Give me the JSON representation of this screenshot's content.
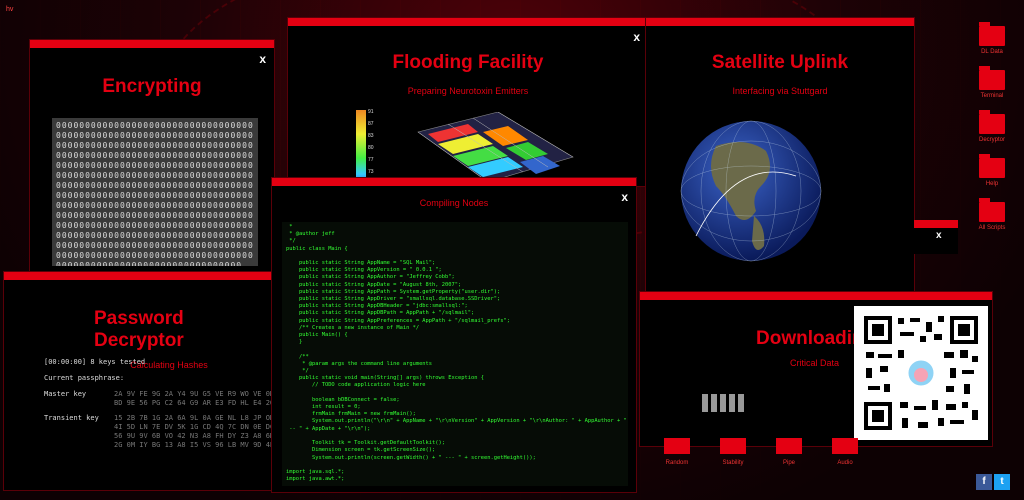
{
  "corner_label": "hv",
  "encrypting": {
    "title": "Encrypting",
    "close": "x",
    "grid": "0000000000000000000000000000000000000000000000000000000000000000000000000000000000000000000000000000000000000000000000000000000000000000000000000000000000000000000000000000000000000000000000000000000000000000000000000000000000000000000000000000000000000000000000000000000000000000000000000000000000000000000000000000000000000000000000000000000000000000000000000000000000000000000000000000000000000000000000000000000000000000000000000000000000000000000000000000000000000000000000000000000000000000000000000000"
  },
  "password": {
    "title": "Password Decryptor",
    "subtitle": "Calculating Hashes",
    "status": "[00:00:00] 8 keys tested",
    "passphrase": "Current passphrase: ",
    "master_label": "Master key",
    "master_value": "2A 9V FE 9G 2A Y4 9U G5 VE R9 WO VE 0D\nBD 9E 56 PG C2 64 G9 AR E3 FD HL E4 20",
    "transient_label": "Transient key",
    "transient_value": "15 2B 7B 1G 2A 6A 9L 0A GE NL L8 JP OK\n4I 5D LN 7E DV 5K 1G CD 4Q 7C DN 0E DC\n56 9U 9V 6B VO 42 N3 A8 FH DY Z3 A8 6D\n2G 0M IY BG 13 A8 I5 VS 96 LB MV 9D 4E"
  },
  "flood": {
    "title": "Flooding Facility",
    "subtitle": "Preparing Neurotoxin Emitters",
    "legend": [
      "91",
      "87",
      "83",
      "80",
      "77",
      "73"
    ]
  },
  "satellite": {
    "title": "Satellite Uplink",
    "subtitle": "Interfacing via Stuttgard",
    "close": "x"
  },
  "code": {
    "title": "Compiling Nodes",
    "close": "x",
    "text": " *\n * @author jeff\n */\npublic class Main {\n\n    public static String AppName = \"SQL Mail\";\n    public static String AppVersion = \" 0.0.1 \";\n    public static String AppAuthor = \"Jeffrey Cobb\";\n    public static String AppDate = \"August 8th, 2007\";\n    public static String AppPath = System.getProperty(\"user.dir\");\n    public static String AppDriver = \"smallsql.database.SSDriver\";\n    public static String AppDBHeader = \"jdbc:smallsql:\";\n    public static String AppDBPath = AppPath + \"/sqlmail\";\n    public static String AppPreferences = AppPath + \"/sqlmail_prefs\";\n    /** Creates a new instance of Main */\n    public Main() {\n    }\n\n    /**\n     * @param args the command line arguments\n     */\n    public static void main(String[] args) throws Exception {\n        // TODO code application logic here\n\n        boolean bDBConnect = false;\n        int result = 0;\n        frmMain frmMain = new frmMain();\n        System.out.println(\"\\r\\n\" + AppName + \"\\r\\nVersion\" + AppVersion + \"\\r\\nAuthor: \" + AppAuthor + \"\n -- \" + AppDate + \"\\r\\n\");\n\n        Toolkit tk = Toolkit.getDefaultToolkit();\n        Dimension screen = tk.getScreenSize();\n        System.out.println(screen.getWidth() + \" --- \" + screen.getHeight());\n\nimport java.sql.*;\nimport java.awt.*;\n\n/**"
  },
  "downloading": {
    "title": "Downloading",
    "subtitle": "Critical Data",
    "progress_blocks": 5
  },
  "buttons": [
    "Random",
    "Stability",
    "Pipe",
    "Audio"
  ],
  "desktop_icons": [
    "DL Data",
    "Terminal",
    "Decryptor",
    "Help",
    "All Scripts"
  ],
  "social": {
    "facebook": "f",
    "twitter": "t"
  }
}
